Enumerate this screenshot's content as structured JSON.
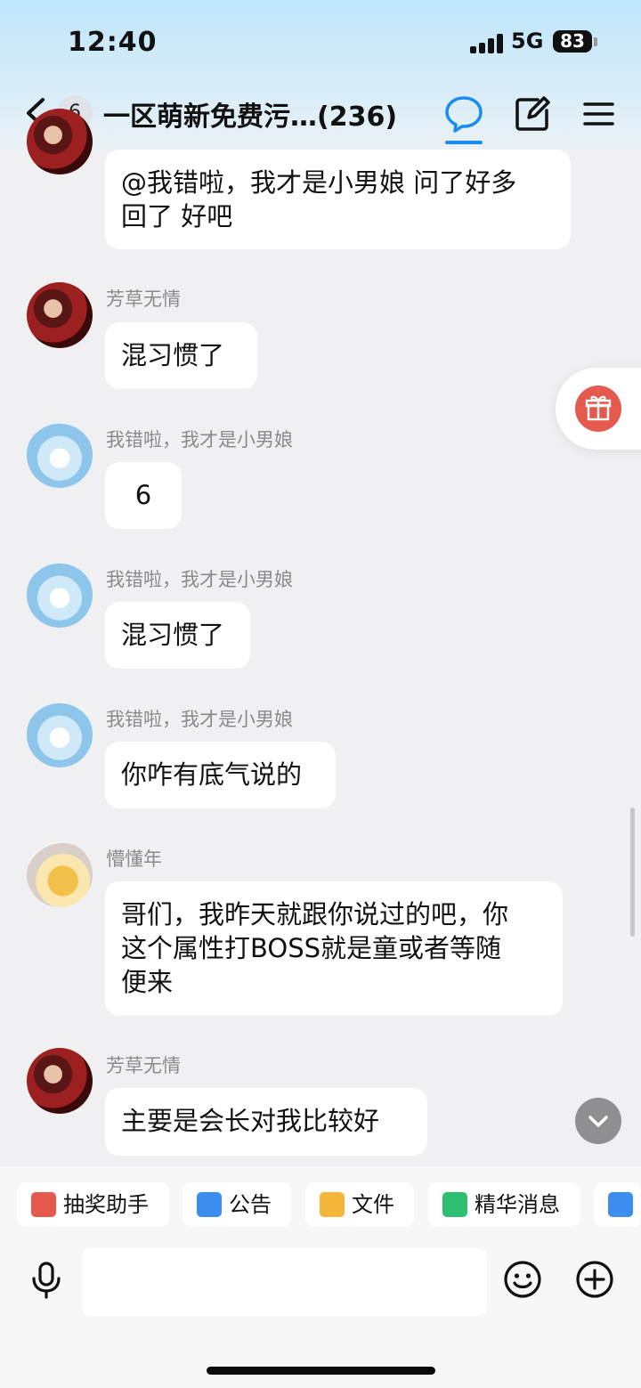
{
  "status": {
    "time": "12:40",
    "network": "5G",
    "battery": "83"
  },
  "header": {
    "unread_count": "6",
    "title": "一区萌新免费污…(236)",
    "icons": [
      "chat-bubble-icon",
      "edit-icon",
      "menu-icon"
    ]
  },
  "messages": [
    {
      "sender": "",
      "text": "@我错啦，我才是小男娘 问了好多\n回了 好吧"
    },
    {
      "sender": "芳草无情",
      "text": "混习惯了"
    },
    {
      "sender": "我错啦，我才是小男娘",
      "text": "6"
    },
    {
      "sender": "我错啦，我才是小男娘",
      "text": "混习惯了"
    },
    {
      "sender": "我错啦，我才是小男娘",
      "text": "你咋有底气说的"
    },
    {
      "sender": "懵懂年",
      "text": "哥们，我昨天就跟你说过的吧，你\n这个属性打BOSS就是童或者等随\n便来"
    },
    {
      "sender": "芳草无情",
      "text": "主要是会长对我比较好"
    }
  ],
  "toolbar": {
    "chips": [
      {
        "label": "抽奖助手",
        "icon": "gift-box-icon",
        "color": "#e5584d"
      },
      {
        "label": "公告",
        "icon": "announcement-icon",
        "color": "#3b8ef0"
      },
      {
        "label": "文件",
        "icon": "folder-icon",
        "color": "#f5b63a"
      },
      {
        "label": "精华消息",
        "icon": "highlight-message-icon",
        "color": "#2fbf71"
      }
    ]
  },
  "input": {
    "placeholder": ""
  },
  "colors": {
    "accent": "#1a8cf0",
    "gift": "#e55a4f"
  }
}
